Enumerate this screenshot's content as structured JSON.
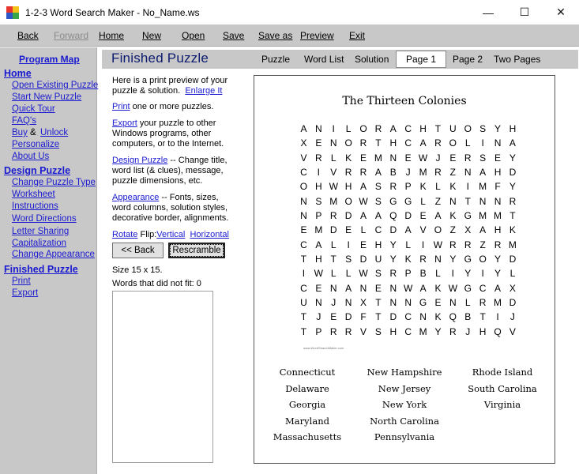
{
  "window": {
    "title": "1-2-3 Word Search Maker - No_Name.ws",
    "controls": {
      "minimize": "—",
      "maximize": "☐",
      "close": "✕"
    }
  },
  "menu": [
    "Back",
    "Forward",
    "Home",
    "New",
    "Open",
    "Save",
    "Save as",
    "Preview",
    "Exit"
  ],
  "sidebar": {
    "program_map": "Program Map",
    "home": "Home",
    "home_items": [
      "Open Existing Puzzle",
      "Start New Puzzle",
      "Quick Tour",
      "FAQ's"
    ],
    "buy": "Buy",
    "amp": "&",
    "unlock": "Unlock",
    "home_items2": [
      "Personalize",
      "About Us"
    ],
    "design": "Design Puzzle",
    "design_items": [
      "Change Puzzle Type",
      "Worksheet",
      "Instructions",
      "Word Directions",
      "Letter Sharing",
      "Capitalization",
      "Change Appearance"
    ],
    "finished": "Finished Puzzle",
    "finished_items": [
      "Print",
      "Export"
    ]
  },
  "header": {
    "title": "Finished Puzzle",
    "tabs": [
      "Puzzle",
      "Word List",
      "Solution",
      "Page 1",
      "Page 2",
      "Two Pages"
    ],
    "active_tab": "Page 1"
  },
  "info": {
    "intro": "Here is a print preview of your puzzle & solution.",
    "enlarge": "Enlarge It",
    "print_link": "Print",
    "print_text": " one or more puzzles.",
    "export_link": "Export",
    "export_text": " your puzzle to other Windows programs, other computers, or to the Internet.",
    "design_link": "Design Puzzle",
    "design_text": " -- Change title, word list (& clues), message, puzzle dimensions, etc.",
    "appearance_link": "Appearance",
    "appearance_text": " -- Fonts, sizes, word columns, solution styles, decorative border, alignments.",
    "rotate": "Rotate",
    "flip": " Flip:",
    "vertical": "Vertical",
    "horizontal": "Horizontal",
    "back_button": "<< Back",
    "rescramble_button": "Rescramble",
    "size": "Size 15 x 15.",
    "unfit": "Words that did not fit: 0"
  },
  "puzzle": {
    "title": "The Thirteen Colonies",
    "grid": [
      "ANILORACHTUOSYH",
      "XENORTHCAROLINA",
      "VRLKEMNEWJERSEY",
      "CIVRRABJMRZNAHD",
      "OHWHASRPKLKIMFY",
      "NSMOWSGGLZNTNNR",
      "NPRDAAQDEAKGMMT",
      "EMDELCDAVOZXAHK",
      "CALIEHYLIWRRZRM",
      "THTSDUYKRNYGOYD",
      "IWLLWSRPBLIYIYL",
      "CENANENWAKWGCAX",
      "UNJNXTNNGENLRMD",
      "TJEDFTDCNKQBTIJ",
      "TPRRVSHCMYRJHQV"
    ],
    "footer_mark": "www.WordSearchMaker.com",
    "words": [
      [
        "Connecticut",
        "Delaware",
        "Georgia",
        "Maryland",
        "Massachusetts"
      ],
      [
        "New Hampshire",
        "New Jersey",
        "New York",
        "North Carolina",
        "Pennsylvania"
      ],
      [
        "Rhode Island",
        "South Carolina",
        "Virginia"
      ]
    ]
  }
}
